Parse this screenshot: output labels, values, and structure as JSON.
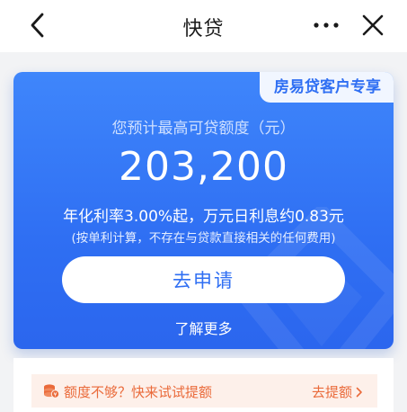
{
  "header": {
    "title": "快贷",
    "back_icon": "chevron-left-icon",
    "more_icon": "more-dots-icon",
    "close_icon": "close-icon"
  },
  "card": {
    "tag": "房易贷客户专享",
    "subtitle": "您预计最高可贷额度（元）",
    "amount": "203,200",
    "rate_text": "年化利率3.00%起，万元日利息约0.83元",
    "note": "(按单利计算，不存在与贷款直接相关的任何费用)",
    "apply_label": "去申请",
    "learn_more": "了解更多",
    "accent_color": "#2f6ff3"
  },
  "tip": {
    "text": "额度不够？快来试试提额",
    "action": "去提额",
    "icon": "coins-icon",
    "color": "#ea6a3a"
  }
}
